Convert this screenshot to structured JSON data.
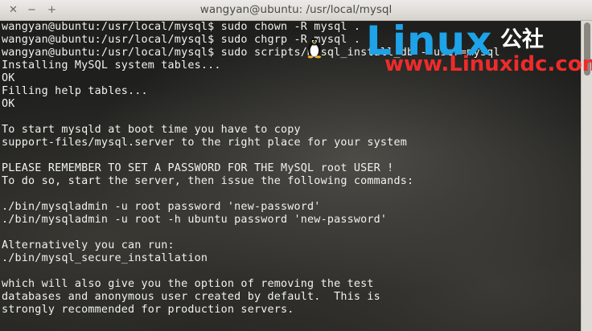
{
  "window": {
    "title": "wangyan@ubuntu: /usr/local/mysql",
    "close_glyph": "✕",
    "minimize_glyph": "−",
    "maximize_glyph": "+"
  },
  "terminal": {
    "lines": [
      "wangyan@ubuntu:/usr/local/mysql$ sudo chown -R mysql .",
      "wangyan@ubuntu:/usr/local/mysql$ sudo chgrp -R mysql .",
      "wangyan@ubuntu:/usr/local/mysql$ sudo scripts/mysql_install_db --user=mysql",
      "Installing MySQL system tables...",
      "OK",
      "Filling help tables...",
      "OK",
      "",
      "To start mysqld at boot time you have to copy",
      "support-files/mysql.server to the right place for your system",
      "",
      "PLEASE REMEMBER TO SET A PASSWORD FOR THE MySQL root USER !",
      "To do so, start the server, then issue the following commands:",
      "",
      "./bin/mysqladmin -u root password 'new-password'",
      "./bin/mysqladmin -u root -h ubuntu password 'new-password'",
      "",
      "Alternatively you can run:",
      "./bin/mysql_secure_installation",
      "",
      "which will also give you the option of removing the test",
      "databases and anonymous user created by default.  This is",
      "strongly recommended for production servers."
    ]
  },
  "watermark": {
    "logo_text": "Linux",
    "logo_suffix": "公社",
    "url": "www.Linuxidc.com",
    "logo_color": "#1ea3e8",
    "url_color": "#ee2b2b"
  },
  "colors": {
    "terminal_fg": "#f2f2ee",
    "terminal_bg": "#1f1f1d",
    "titlebar": "#dcd9d3"
  }
}
